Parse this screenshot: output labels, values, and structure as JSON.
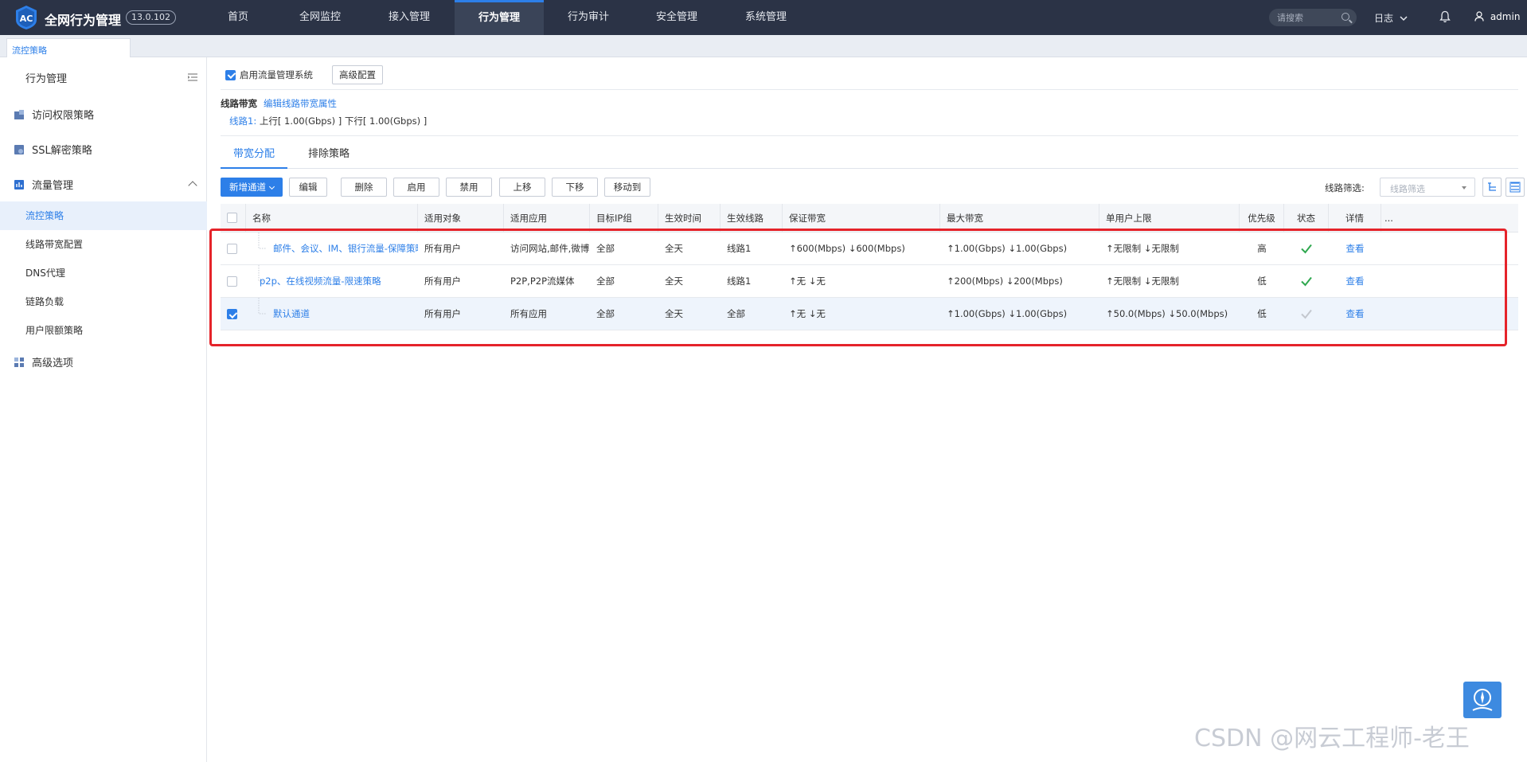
{
  "app": {
    "logo_text": "AC",
    "brand": "全网行为管理",
    "version": "13.0.102"
  },
  "nav": {
    "items": [
      {
        "label": "首页"
      },
      {
        "label": "全网监控"
      },
      {
        "label": "接入管理"
      },
      {
        "label": "行为管理",
        "active": true
      },
      {
        "label": "行为审计"
      },
      {
        "label": "安全管理"
      },
      {
        "label": "系统管理"
      }
    ],
    "search_placeholder": "请搜索",
    "log_label": "日志",
    "user_label": "admin"
  },
  "tabstrip": {
    "current": "流控策略"
  },
  "sidebar": {
    "title": "行为管理",
    "groups": [
      {
        "label": "访问权限策略",
        "icon": "access-policy-icon"
      },
      {
        "label": "SSL解密策略",
        "icon": "ssl-icon"
      },
      {
        "label": "流量管理",
        "icon": "traffic-icon",
        "expanded": true
      },
      {
        "label": "高级选项",
        "icon": "advanced-icon"
      }
    ],
    "sub_items": [
      {
        "label": "流控策略",
        "active": true
      },
      {
        "label": "线路带宽配置"
      },
      {
        "label": "DNS代理"
      },
      {
        "label": "链路负载"
      },
      {
        "label": "用户限额策略"
      }
    ]
  },
  "main": {
    "enable_label": "启用流量管理系统",
    "enable_checked": true,
    "advanced_btn": "高级配置",
    "bandwidth": {
      "title": "线路带宽",
      "edit_link": "编辑线路带宽属性",
      "line_name": "线路1:",
      "line_value": "上行[ 1.00(Gbps) ] 下行[ 1.00(Gbps) ]"
    },
    "tabs": [
      {
        "label": "带宽分配",
        "active": true
      },
      {
        "label": "排除策略"
      }
    ],
    "toolbar": {
      "add": "新增通道",
      "edit": "编辑",
      "delete": "删除",
      "enable": "启用",
      "disable": "禁用",
      "up": "上移",
      "down": "下移",
      "move_to": "移动到",
      "filter_label": "线路筛选:",
      "filter_placeholder": "线路筛选"
    },
    "table": {
      "headers": [
        "名称",
        "适用对象",
        "适用应用",
        "目标IP组",
        "生效时间",
        "生效线路",
        "保证带宽",
        "最大带宽",
        "单用户上限",
        "优先级",
        "状态",
        "详情",
        "..."
      ],
      "rows": [
        {
          "checked": false,
          "name": "邮件、会议、IM、银行流量-保障策略",
          "object": "所有用户",
          "app": "访问网站,邮件,微博,...",
          "ip": "全部",
          "time": "全天",
          "line": "线路1",
          "guarantee": "↑600(Mbps) ↓600(Mbps)",
          "max": "↑1.00(Gbps) ↓1.00(Gbps)",
          "per_user": "↑无限制 ↓无限制",
          "priority": "高",
          "status": "enabled",
          "detail": "查看"
        },
        {
          "checked": false,
          "name": "p2p、在线视频流量-限速策略",
          "object": "所有用户",
          "app": "P2P,P2P流媒体",
          "ip": "全部",
          "time": "全天",
          "line": "线路1",
          "guarantee": "↑无 ↓无",
          "max": "↑200(Mbps) ↓200(Mbps)",
          "per_user": "↑无限制 ↓无限制",
          "priority": "低",
          "status": "enabled",
          "detail": "查看"
        },
        {
          "checked": true,
          "name": "默认通道",
          "object": "所有用户",
          "app": "所有应用",
          "ip": "全部",
          "time": "全天",
          "line": "全部",
          "guarantee": "↑无 ↓无",
          "max": "↑1.00(Gbps) ↓1.00(Gbps)",
          "per_user": "↑50.0(Mbps) ↓50.0(Mbps)",
          "priority": "低",
          "status": "default",
          "detail": "查看"
        }
      ]
    }
  },
  "watermark": "CSDN @网云工程师-老王",
  "colors": {
    "nav_bg": "#2b3346",
    "accent": "#2d7fe8",
    "highlight_box": "#e5232a",
    "ok_green": "#2fa84f"
  }
}
